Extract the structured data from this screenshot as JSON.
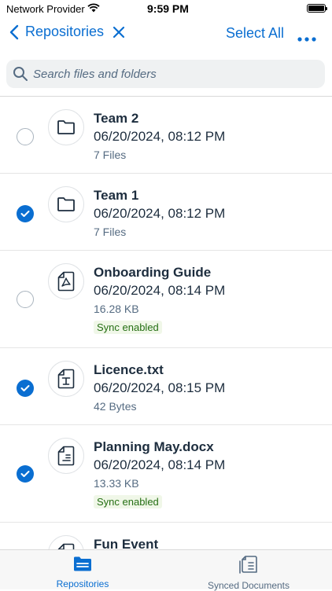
{
  "status_bar": {
    "carrier": "Network Provider",
    "time": "9:59 PM"
  },
  "nav": {
    "back_label": "Repositories",
    "select_all": "Select All"
  },
  "search": {
    "placeholder": "Search files and folders"
  },
  "files": [
    {
      "title": "Team 2",
      "date": "06/20/2024, 08:12 PM",
      "meta": "7 Files",
      "selected": false,
      "type": "folder"
    },
    {
      "title": "Team 1",
      "date": "06/20/2024, 08:12 PM",
      "meta": "7 Files",
      "selected": true,
      "type": "folder"
    },
    {
      "title": "Onboarding Guide",
      "date": "06/20/2024, 08:14 PM",
      "meta": "16.28 KB",
      "badge": "Sync enabled",
      "selected": false,
      "type": "pdf"
    },
    {
      "title": "Licence.txt",
      "date": "06/20/2024, 08:15 PM",
      "meta": "42 Bytes",
      "selected": true,
      "type": "text"
    },
    {
      "title": "Planning May.docx",
      "date": "06/20/2024, 08:14 PM",
      "meta": "13.33 KB",
      "badge": "Sync enabled",
      "selected": true,
      "type": "doc"
    },
    {
      "title": "Fun Event",
      "selected": false,
      "type": "doc"
    }
  ],
  "tabs": {
    "repositories": "Repositories",
    "synced": "Synced Documents"
  },
  "colors": {
    "accent": "#0a6ed1",
    "text": "#1d2d3e",
    "secondary": "#556b82",
    "badge_bg": "#f0f7e8",
    "badge_text": "#256f14"
  }
}
